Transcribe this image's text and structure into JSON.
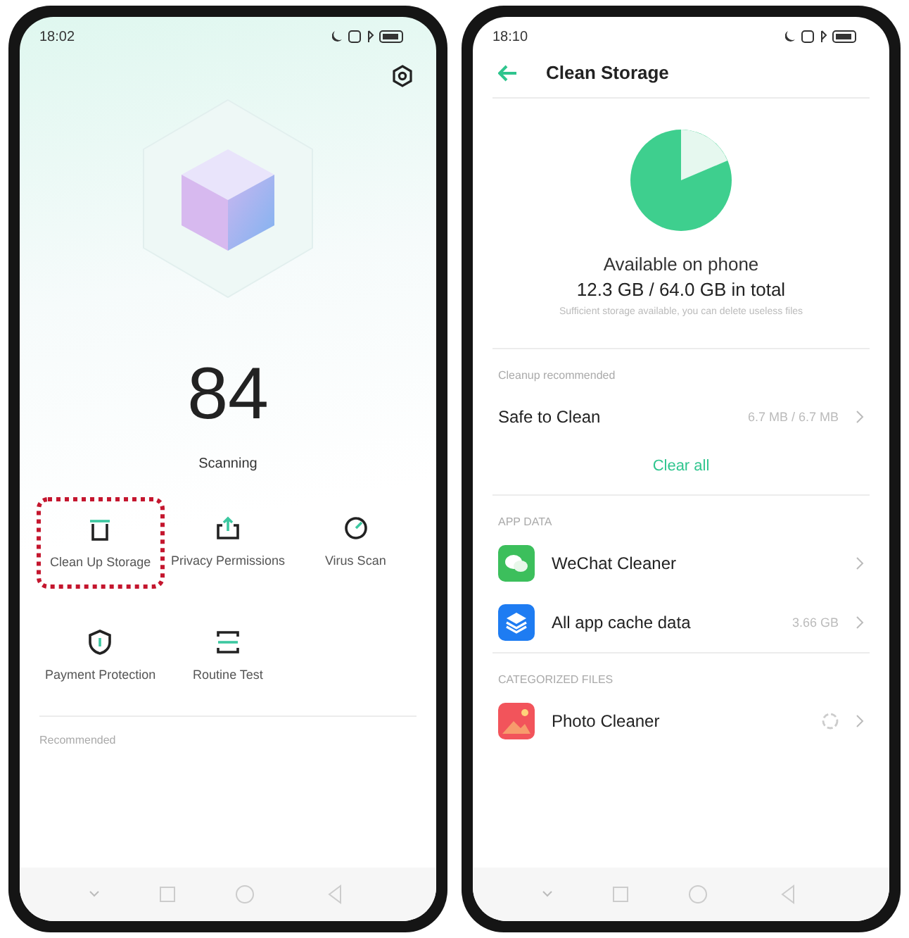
{
  "left_phone": {
    "status_bar": {
      "time": "18:02"
    },
    "score": "84",
    "status": "Scanning",
    "tools": [
      {
        "kind": "trash",
        "label": "Clean Up Storage",
        "selected": true
      },
      {
        "kind": "share",
        "label": "Privacy Permissions",
        "selected": false
      },
      {
        "kind": "gauge",
        "label": "Virus Scan",
        "selected": false
      },
      {
        "kind": "shield",
        "label": "Payment Protection",
        "selected": false
      },
      {
        "kind": "scan",
        "label": "Routine Test",
        "selected": false
      }
    ],
    "section": "Recommended"
  },
  "right_phone": {
    "status_bar": {
      "time": "18:10"
    },
    "title": "Clean Storage",
    "storage": {
      "heading": "Available on phone",
      "amount": "12.3 GB / 64.0 GB in total",
      "hint": "Sufficient storage available, you can delete useless files"
    },
    "cleanup": {
      "heading": "Cleanup recommended",
      "label": "Safe to Clean",
      "value": "6.7 MB / 6.7 MB",
      "action": "Clear all"
    },
    "sections": [
      {
        "heading": "APP DATA",
        "rows": [
          {
            "kind": "chat",
            "label": "WeChat Cleaner",
            "loading": false
          },
          {
            "kind": "layers",
            "label": "All app cache data",
            "value": "3.66 GB",
            "loading": false
          }
        ]
      },
      {
        "heading": "CATEGORIZED FILES",
        "rows": [
          {
            "kind": "photo",
            "label": "Photo Cleaner",
            "loading": true
          }
        ]
      }
    ]
  }
}
